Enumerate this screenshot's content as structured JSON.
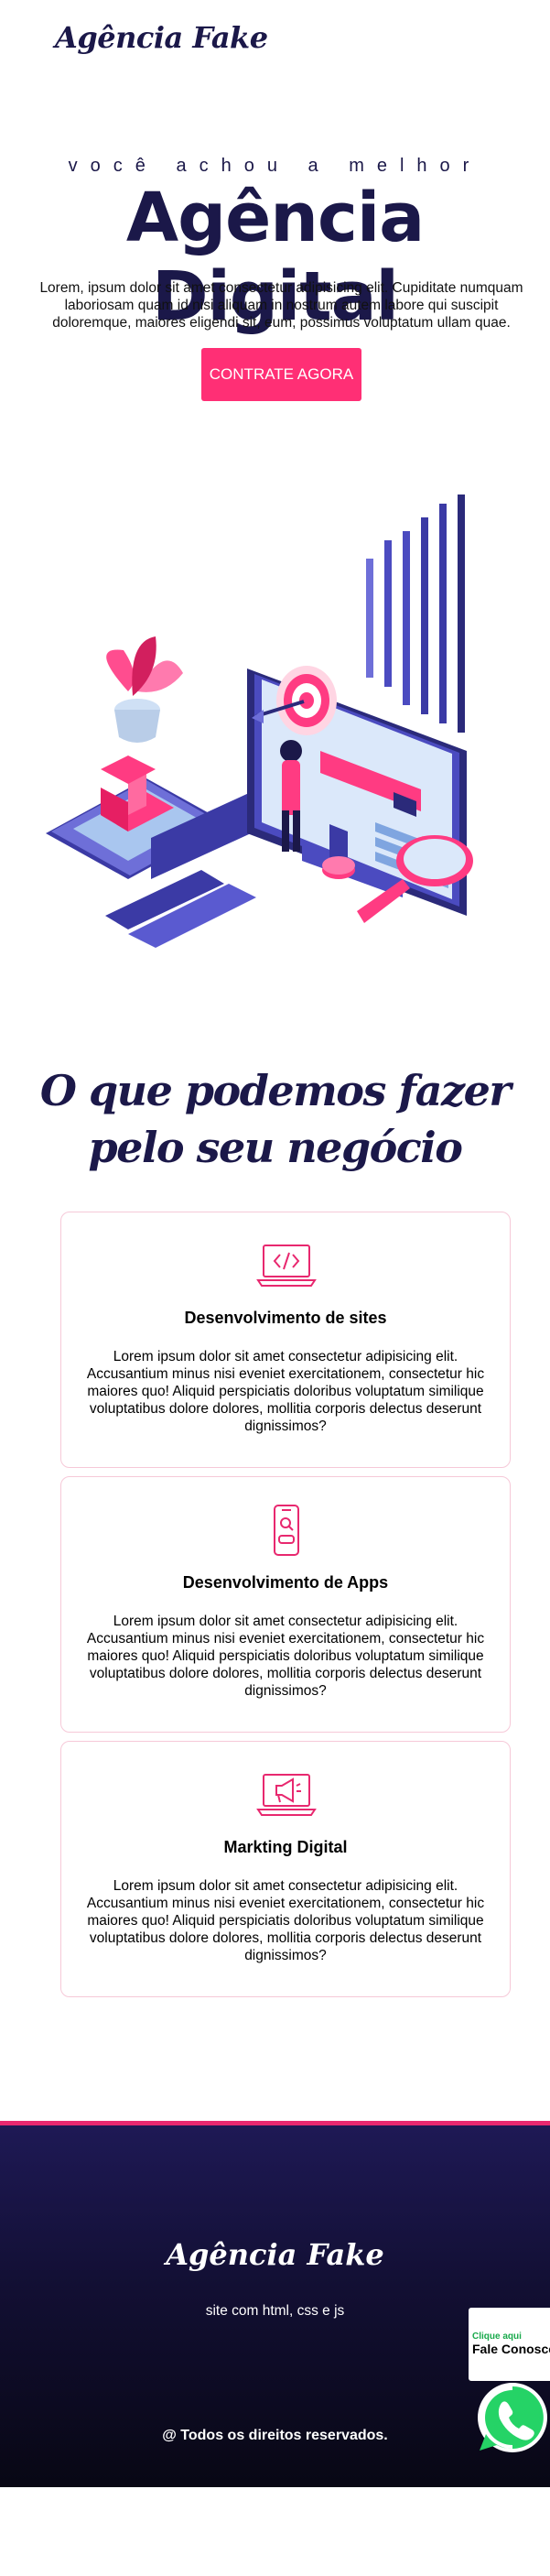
{
  "header": {
    "logo": "Agência Fake"
  },
  "hero": {
    "kicker": "você achou a melhor",
    "title": "Agência Digital",
    "text": "Lorem, ipsum dolor sit amet consectetur adipisicing elit. Cupiditate numquam laboriosam quam id nisi aliquam in nostrum autem labore qui suscipit doloremque, maiores eligendi sit, eum, possimus voluptatum ullam quae.",
    "cta_label": "CONTRATE AGORA"
  },
  "colors": {
    "brand_navy": "#1b1849",
    "accent_pink": "#ff2f75",
    "whatsapp_green": "#25d366"
  },
  "services": {
    "title": "O que podemos fazer pelo seu negócio",
    "cards": [
      {
        "icon": "code-laptop-icon",
        "title": "Desenvolvimento de sites",
        "text": "Lorem ipsum dolor sit amet consectetur adipisicing elit. Accusantium minus nisi eveniet exercitationem, consectetur hic maiores quo! Aliquid perspiciatis doloribus voluptatum similique voluptatibus dolore dolores, mollitia corporis delectus deserunt dignissimos?"
      },
      {
        "icon": "mobile-search-icon",
        "title": "Desenvolvimento de Apps",
        "text": "Lorem ipsum dolor sit amet consectetur adipisicing elit. Accusantium minus nisi eveniet exercitationem, consectetur hic maiores quo! Aliquid perspiciatis doloribus voluptatum similique voluptatibus dolore dolores, mollitia corporis delectus deserunt dignissimos?"
      },
      {
        "icon": "megaphone-laptop-icon",
        "title": "Markting Digital",
        "text": "Lorem ipsum dolor sit amet consectetur adipisicing elit. Accusantium minus nisi eveniet exercitationem, consectetur hic maiores quo! Aliquid perspiciatis doloribus voluptatum similique voluptatibus dolore dolores, mollitia corporis delectus deserunt dignissimos?"
      }
    ]
  },
  "footer": {
    "logo": "Agência Fake",
    "subtitle": "site com html, css e js",
    "copyright": "@ Todos os direitos reservados."
  },
  "whatsapp": {
    "line1": "Clique aqui",
    "line2": "Fale Conosco",
    "icon": "whatsapp-icon"
  }
}
